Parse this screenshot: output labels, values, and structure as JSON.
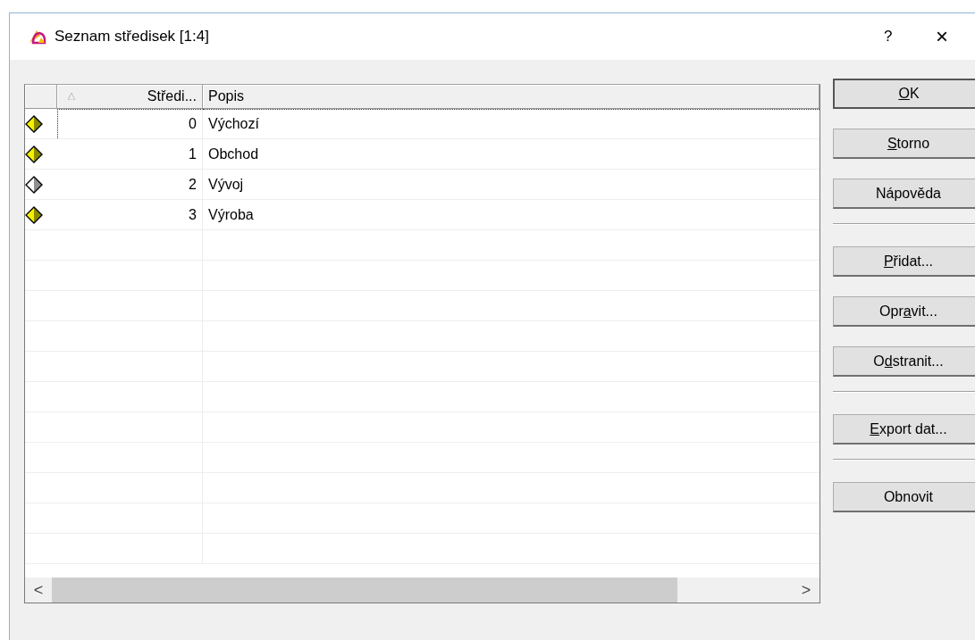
{
  "window": {
    "title": "Seznam středisek  [1:4]",
    "help": "?",
    "close": "×"
  },
  "table": {
    "columns": [
      {
        "label": "Středi...",
        "sorted": true
      },
      {
        "label": "Popis",
        "sorted": false
      }
    ],
    "rows": [
      {
        "active": true,
        "focused": true,
        "number": "0",
        "description": "Výchozí"
      },
      {
        "active": true,
        "focused": false,
        "number": "1",
        "description": "Obchod"
      },
      {
        "active": false,
        "focused": false,
        "number": "2",
        "description": "Vývoj"
      },
      {
        "active": true,
        "focused": false,
        "number": "3",
        "description": "Výroba"
      }
    ],
    "scroll_left": "<",
    "scroll_right": ">"
  },
  "buttons": [
    {
      "kind": "button",
      "key": "O",
      "post": "K",
      "default": true
    },
    {
      "kind": "button",
      "key": "S",
      "post": "torno",
      "default": false
    },
    {
      "kind": "button",
      "pre": "Nápověda",
      "default": false
    },
    {
      "kind": "separator"
    },
    {
      "kind": "button",
      "key": "P",
      "post": "řidat...",
      "default": false
    },
    {
      "kind": "button",
      "pre": "Opr",
      "key": "a",
      "post": "vit...",
      "default": false
    },
    {
      "kind": "button",
      "pre": "O",
      "key": "d",
      "post": "stranit...",
      "default": false
    },
    {
      "kind": "separator"
    },
    {
      "kind": "button",
      "key": "E",
      "post": "xport dat...",
      "default": false
    },
    {
      "kind": "separator"
    },
    {
      "kind": "button",
      "pre": "Obnovit",
      "default": false
    }
  ]
}
